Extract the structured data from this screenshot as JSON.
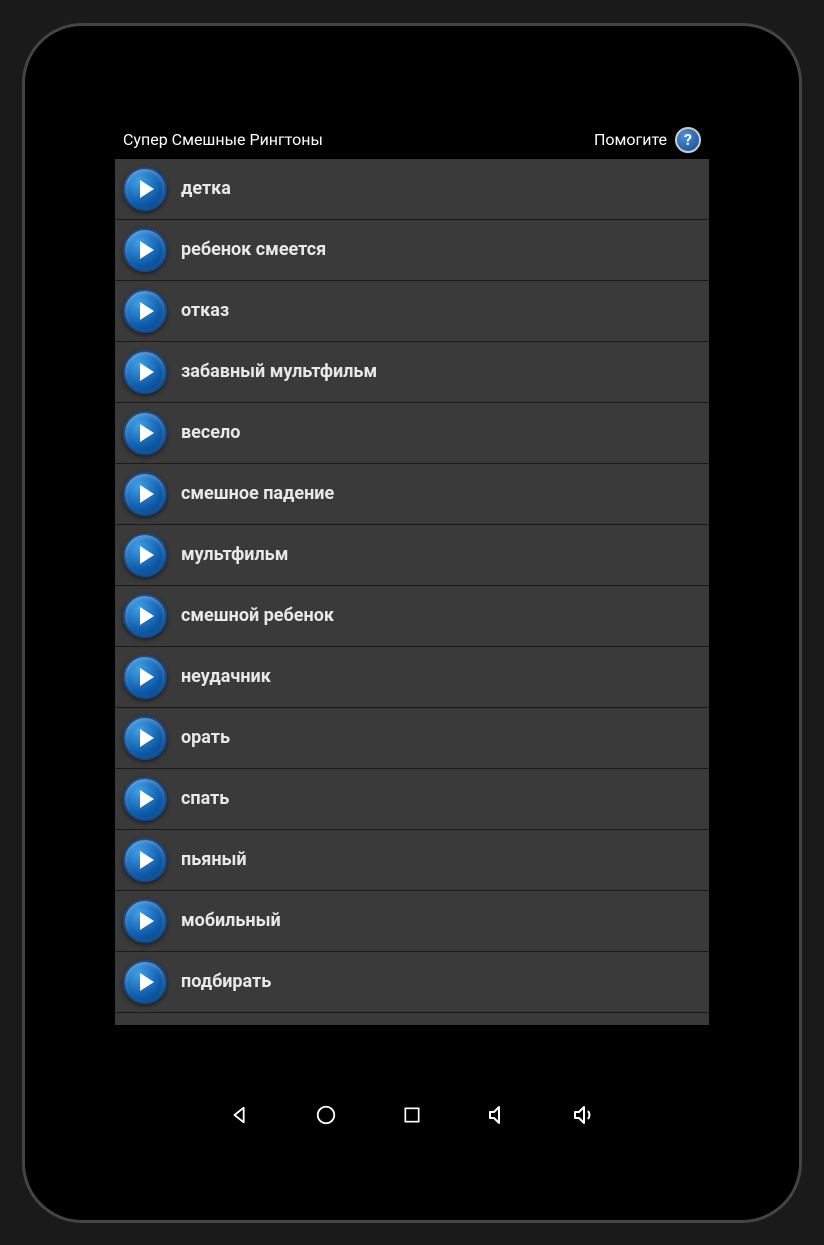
{
  "header": {
    "title": "Супер Смешные Рингтоны",
    "help_label": "Помогите"
  },
  "ringtones": [
    {
      "label": "детка"
    },
    {
      "label": "ребенок смеется"
    },
    {
      "label": "отказ"
    },
    {
      "label": "забавный мультфильм"
    },
    {
      "label": "весело"
    },
    {
      "label": "смешное падение"
    },
    {
      "label": "мультфильм"
    },
    {
      "label": "смешной ребенок"
    },
    {
      "label": "неудачник"
    },
    {
      "label": "орать"
    },
    {
      "label": "спать"
    },
    {
      "label": "пьяный"
    },
    {
      "label": "мобильный"
    },
    {
      "label": "подбирать"
    }
  ]
}
